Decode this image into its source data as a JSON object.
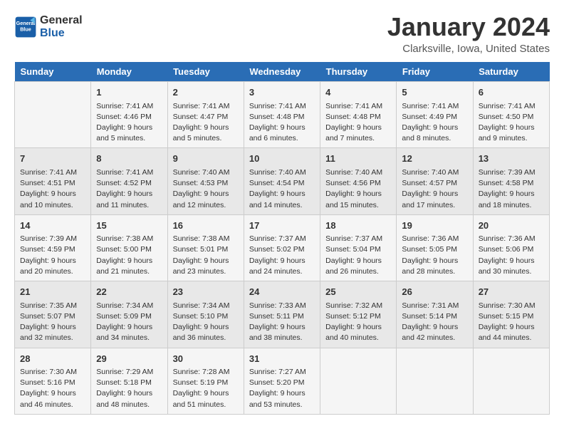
{
  "header": {
    "logo_line1": "General",
    "logo_line2": "Blue",
    "month_title": "January 2024",
    "location": "Clarksville, Iowa, United States"
  },
  "weekdays": [
    "Sunday",
    "Monday",
    "Tuesday",
    "Wednesday",
    "Thursday",
    "Friday",
    "Saturday"
  ],
  "weeks": [
    [
      {
        "day": "",
        "content": ""
      },
      {
        "day": "1",
        "content": "Sunrise: 7:41 AM\nSunset: 4:46 PM\nDaylight: 9 hours\nand 5 minutes."
      },
      {
        "day": "2",
        "content": "Sunrise: 7:41 AM\nSunset: 4:47 PM\nDaylight: 9 hours\nand 5 minutes."
      },
      {
        "day": "3",
        "content": "Sunrise: 7:41 AM\nSunset: 4:48 PM\nDaylight: 9 hours\nand 6 minutes."
      },
      {
        "day": "4",
        "content": "Sunrise: 7:41 AM\nSunset: 4:48 PM\nDaylight: 9 hours\nand 7 minutes."
      },
      {
        "day": "5",
        "content": "Sunrise: 7:41 AM\nSunset: 4:49 PM\nDaylight: 9 hours\nand 8 minutes."
      },
      {
        "day": "6",
        "content": "Sunrise: 7:41 AM\nSunset: 4:50 PM\nDaylight: 9 hours\nand 9 minutes."
      }
    ],
    [
      {
        "day": "7",
        "content": "Sunrise: 7:41 AM\nSunset: 4:51 PM\nDaylight: 9 hours\nand 10 minutes."
      },
      {
        "day": "8",
        "content": "Sunrise: 7:41 AM\nSunset: 4:52 PM\nDaylight: 9 hours\nand 11 minutes."
      },
      {
        "day": "9",
        "content": "Sunrise: 7:40 AM\nSunset: 4:53 PM\nDaylight: 9 hours\nand 12 minutes."
      },
      {
        "day": "10",
        "content": "Sunrise: 7:40 AM\nSunset: 4:54 PM\nDaylight: 9 hours\nand 14 minutes."
      },
      {
        "day": "11",
        "content": "Sunrise: 7:40 AM\nSunset: 4:56 PM\nDaylight: 9 hours\nand 15 minutes."
      },
      {
        "day": "12",
        "content": "Sunrise: 7:40 AM\nSunset: 4:57 PM\nDaylight: 9 hours\nand 17 minutes."
      },
      {
        "day": "13",
        "content": "Sunrise: 7:39 AM\nSunset: 4:58 PM\nDaylight: 9 hours\nand 18 minutes."
      }
    ],
    [
      {
        "day": "14",
        "content": "Sunrise: 7:39 AM\nSunset: 4:59 PM\nDaylight: 9 hours\nand 20 minutes."
      },
      {
        "day": "15",
        "content": "Sunrise: 7:38 AM\nSunset: 5:00 PM\nDaylight: 9 hours\nand 21 minutes."
      },
      {
        "day": "16",
        "content": "Sunrise: 7:38 AM\nSunset: 5:01 PM\nDaylight: 9 hours\nand 23 minutes."
      },
      {
        "day": "17",
        "content": "Sunrise: 7:37 AM\nSunset: 5:02 PM\nDaylight: 9 hours\nand 24 minutes."
      },
      {
        "day": "18",
        "content": "Sunrise: 7:37 AM\nSunset: 5:04 PM\nDaylight: 9 hours\nand 26 minutes."
      },
      {
        "day": "19",
        "content": "Sunrise: 7:36 AM\nSunset: 5:05 PM\nDaylight: 9 hours\nand 28 minutes."
      },
      {
        "day": "20",
        "content": "Sunrise: 7:36 AM\nSunset: 5:06 PM\nDaylight: 9 hours\nand 30 minutes."
      }
    ],
    [
      {
        "day": "21",
        "content": "Sunrise: 7:35 AM\nSunset: 5:07 PM\nDaylight: 9 hours\nand 32 minutes."
      },
      {
        "day": "22",
        "content": "Sunrise: 7:34 AM\nSunset: 5:09 PM\nDaylight: 9 hours\nand 34 minutes."
      },
      {
        "day": "23",
        "content": "Sunrise: 7:34 AM\nSunset: 5:10 PM\nDaylight: 9 hours\nand 36 minutes."
      },
      {
        "day": "24",
        "content": "Sunrise: 7:33 AM\nSunset: 5:11 PM\nDaylight: 9 hours\nand 38 minutes."
      },
      {
        "day": "25",
        "content": "Sunrise: 7:32 AM\nSunset: 5:12 PM\nDaylight: 9 hours\nand 40 minutes."
      },
      {
        "day": "26",
        "content": "Sunrise: 7:31 AM\nSunset: 5:14 PM\nDaylight: 9 hours\nand 42 minutes."
      },
      {
        "day": "27",
        "content": "Sunrise: 7:30 AM\nSunset: 5:15 PM\nDaylight: 9 hours\nand 44 minutes."
      }
    ],
    [
      {
        "day": "28",
        "content": "Sunrise: 7:30 AM\nSunset: 5:16 PM\nDaylight: 9 hours\nand 46 minutes."
      },
      {
        "day": "29",
        "content": "Sunrise: 7:29 AM\nSunset: 5:18 PM\nDaylight: 9 hours\nand 48 minutes."
      },
      {
        "day": "30",
        "content": "Sunrise: 7:28 AM\nSunset: 5:19 PM\nDaylight: 9 hours\nand 51 minutes."
      },
      {
        "day": "31",
        "content": "Sunrise: 7:27 AM\nSunset: 5:20 PM\nDaylight: 9 hours\nand 53 minutes."
      },
      {
        "day": "",
        "content": ""
      },
      {
        "day": "",
        "content": ""
      },
      {
        "day": "",
        "content": ""
      }
    ]
  ]
}
